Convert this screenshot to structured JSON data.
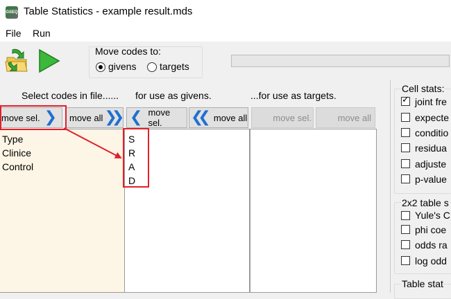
{
  "window": {
    "title": "Table Statistics - example result.mds",
    "icon_text": "GSEQ"
  },
  "menu": {
    "file": "File",
    "run": "Run"
  },
  "toolbar": {
    "move_codes_label": "Move codes to:",
    "givens_label": "givens",
    "targets_label": "targets",
    "selected": "givens"
  },
  "columns": {
    "header_file": "Select codes in file......",
    "header_givens": "for use as givens.",
    "header_targets": "...for use as targets."
  },
  "buttons": {
    "move_sel_right": "move sel.",
    "move_all_right": "move all",
    "move_sel_left": "move sel.",
    "move_all_left": "move all",
    "move_sel_targets": "move sel.",
    "move_all_targets": "move all"
  },
  "file_codes": [
    "Type",
    "Clinice",
    "Control"
  ],
  "givens_codes": [
    "S",
    "R",
    "A",
    "D"
  ],
  "target_codes": [],
  "cell_stats": {
    "title": "Cell stats:",
    "items": [
      {
        "label": "joint fre",
        "checked": true
      },
      {
        "label": "expecte",
        "checked": false
      },
      {
        "label": "conditio",
        "checked": false
      },
      {
        "label": "residua",
        "checked": false
      },
      {
        "label": "adjuste",
        "checked": false
      },
      {
        "label": "p-value",
        "checked": false
      }
    ]
  },
  "two_by_two": {
    "title": "2x2 table s",
    "items": [
      {
        "label": "Yule's C",
        "checked": false
      },
      {
        "label": "phi coe",
        "checked": false
      },
      {
        "label": "odds ra",
        "checked": false
      },
      {
        "label": "log odd",
        "checked": false
      }
    ]
  },
  "table_stats": {
    "title": "Table stat"
  },
  "colors": {
    "highlight": "#e0202a",
    "file_list_bg": "#fdf5e6",
    "chevron": "#1f6fd0"
  }
}
